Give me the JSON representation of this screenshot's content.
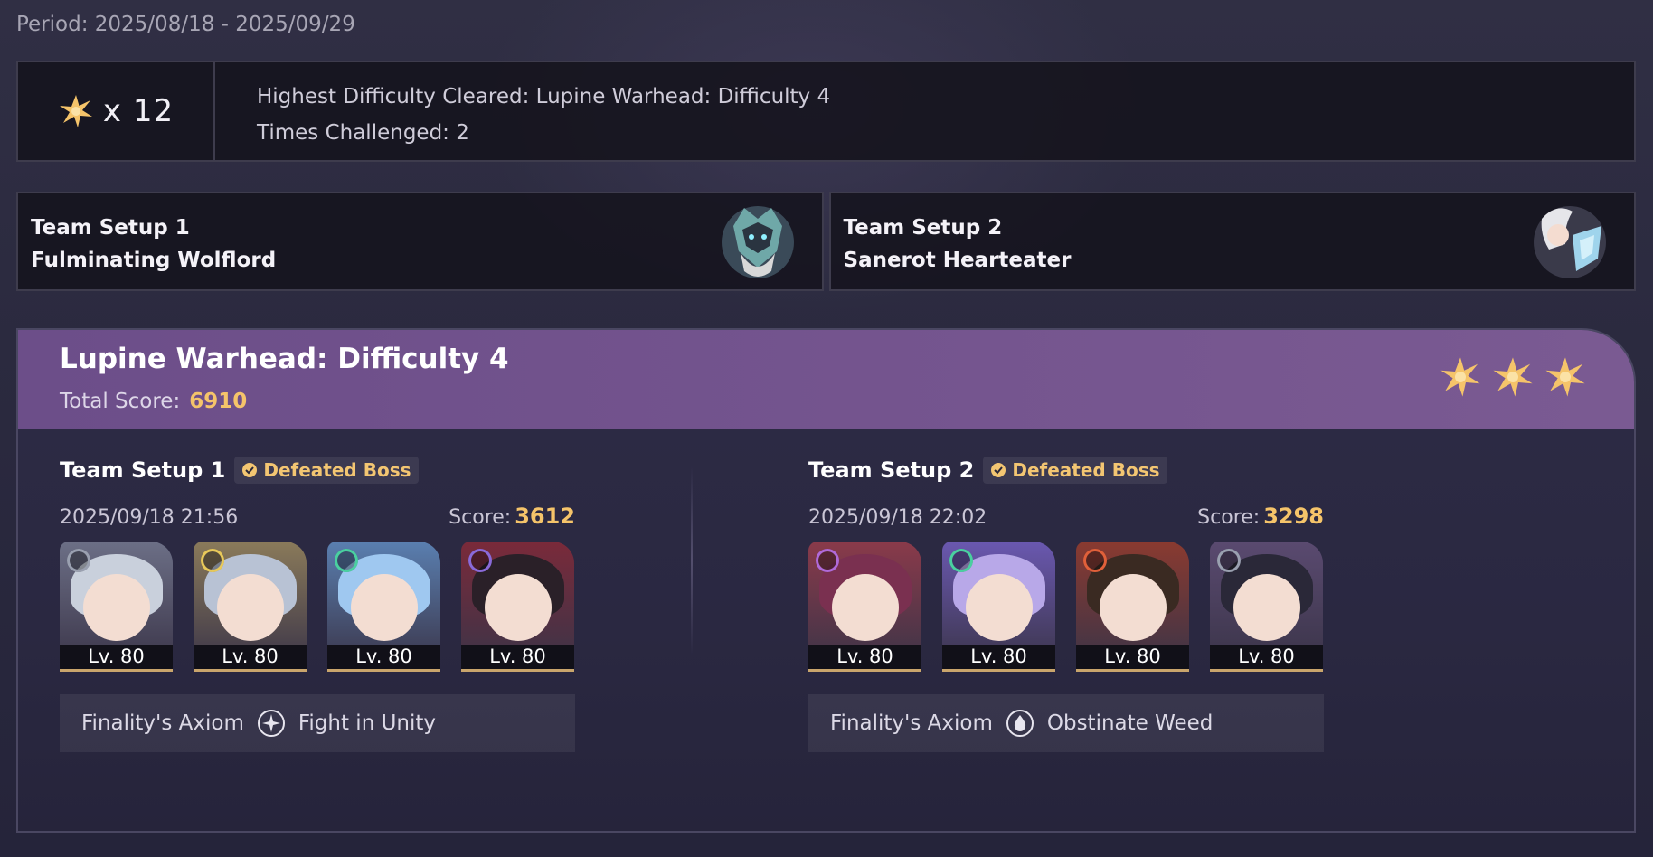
{
  "period": "Period: 2025/08/18 - 2025/09/29",
  "summary": {
    "star_count": "x 12",
    "highest_difficulty": "Highest Difficulty Cleared: Lupine Warhead: Difficulty 4",
    "times_challenged": "Times Challenged: 2"
  },
  "team_cards": [
    {
      "title": "Team Setup 1",
      "boss": "Fulminating Wolflord",
      "boss_icon": "wolflord-portrait"
    },
    {
      "title": "Team Setup 2",
      "boss": "Sanerot Hearteater",
      "boss_icon": "hearteater-portrait"
    }
  ],
  "stage": {
    "title": "Lupine Warhead: Difficulty 4",
    "total_score_label": "Total Score:",
    "total_score": "6910",
    "stars_earned": 3
  },
  "setups": [
    {
      "title": "Team Setup 1",
      "badge": "Defeated Boss",
      "timestamp": "2025/09/18 21:56",
      "score_label": "Score:",
      "score": "3612",
      "characters": [
        {
          "level": "Lv. 80",
          "element_color": "#9aa0b0",
          "hair": "#c9d0dc",
          "bg": "#6c6f86"
        },
        {
          "level": "Lv. 80",
          "element_color": "#e8c95a",
          "hair": "#b8c2d4",
          "bg": "#8a7a5a"
        },
        {
          "level": "Lv. 80",
          "element_color": "#4ad0a0",
          "hair": "#9fc8f0",
          "bg": "#5a7fb0"
        },
        {
          "level": "Lv. 80",
          "element_color": "#8a6ad8",
          "hair": "#2a2028",
          "bg": "#7a2a3a"
        }
      ],
      "buff_name": "Finality's Axiom",
      "buff_value": "Fight in Unity",
      "buff_icon": "sparkle-icon"
    },
    {
      "title": "Team Setup 2",
      "badge": "Defeated Boss",
      "timestamp": "2025/09/18 22:02",
      "score_label": "Score:",
      "score": "3298",
      "characters": [
        {
          "level": "Lv. 80",
          "element_color": "#b06ad8",
          "hair": "#7a3050",
          "bg": "#8a3a4a"
        },
        {
          "level": "Lv. 80",
          "element_color": "#4ad0a0",
          "hair": "#b8a8e8",
          "bg": "#6a58b0"
        },
        {
          "level": "Lv. 80",
          "element_color": "#e0603a",
          "hair": "#3a2a22",
          "bg": "#8a3a30"
        },
        {
          "level": "Lv. 80",
          "element_color": "#9aa0b0",
          "hair": "#2a2838",
          "bg": "#5a4a70"
        }
      ],
      "buff_name": "Finality's Axiom",
      "buff_value": "Obstinate Weed",
      "buff_icon": "droplet-icon"
    }
  ]
}
